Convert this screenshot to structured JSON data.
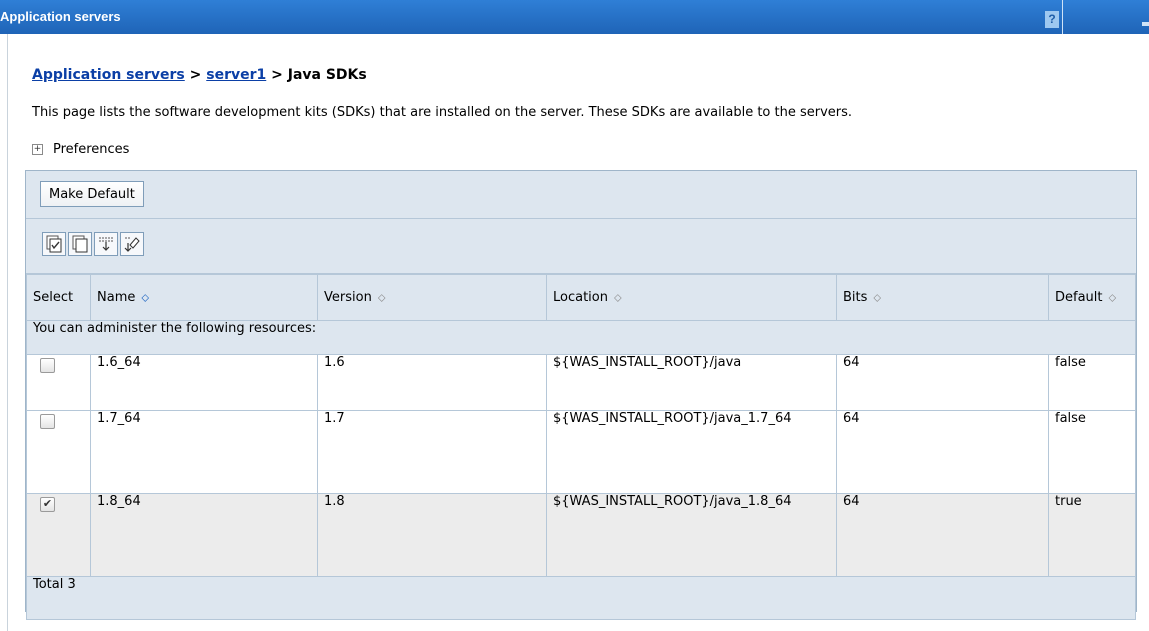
{
  "window": {
    "title": "Application servers",
    "help_label": "?"
  },
  "breadcrumb": {
    "level1": "Application servers",
    "sep1": " > ",
    "level2": "server1",
    "sep2": " > ",
    "current": "Java SDKs"
  },
  "description": "This page lists the software development kits (SDKs) that are installed on the server. These SDKs are available to the servers.",
  "preferences": {
    "expand_icon": "+",
    "label": "Preferences"
  },
  "toolbar": {
    "make_default_label": "Make Default"
  },
  "icon_toolbar": [
    "select-all-icon",
    "deselect-all-icon",
    "show-filter-icon",
    "clear-filter-icon"
  ],
  "table": {
    "headers": [
      "Select",
      "Name",
      "Version",
      "Location",
      "Bits",
      "Default"
    ],
    "sort_glyph": "⬦",
    "section_label": "You can administer the following resources:",
    "rows": [
      {
        "checked": false,
        "check": "",
        "name": "1.6_64",
        "version": "1.6",
        "location": "${WAS_INSTALL_ROOT}/java",
        "bits": "64",
        "default": "false"
      },
      {
        "checked": false,
        "check": "",
        "name": "1.7_64",
        "version": "1.7",
        "location": "${WAS_INSTALL_ROOT}/java_1.7_64",
        "bits": "64",
        "default": "false"
      },
      {
        "checked": true,
        "check": "✔",
        "name": "1.8_64",
        "version": "1.8",
        "location": "${WAS_INSTALL_ROOT}/java_1.8_64",
        "bits": "64",
        "default": "true"
      }
    ],
    "total_label": "Total 3"
  },
  "colors": {
    "title_bar": "#1f64b7",
    "link": "#0b3fa6",
    "panel_bg": "#dde6ef",
    "selected_row_bg": "#ececec"
  }
}
